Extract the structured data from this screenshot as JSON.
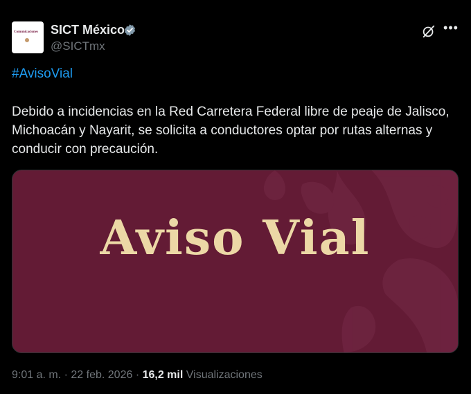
{
  "author": {
    "name": "SICT México",
    "handle": "@SICTmx",
    "avatar_text": "Comunicaciones"
  },
  "post": {
    "hashtag": "#AvisoVial",
    "text": "Debido a incidencias en la Red Carretera Federal libre de peaje de Jalisco, Michoacán y Nayarit, se solicita a conductores optar por rutas alternas y conducir con precaución.",
    "media_title": "Aviso Vial"
  },
  "meta": {
    "time": "9:01 a. m.",
    "separator": "·",
    "date": "22 feb. 2026",
    "views_count": "16,2 mil",
    "views_label": "Visualizaciones"
  },
  "icons": {
    "verified": "verified-badge-icon",
    "grok": "grok-icon",
    "more": "more-options-icon"
  },
  "colors": {
    "background": "#000000",
    "link": "#1d9bf0",
    "muted": "#71767b",
    "media_bg": "#631b35",
    "media_text": "#ecd8a6"
  }
}
